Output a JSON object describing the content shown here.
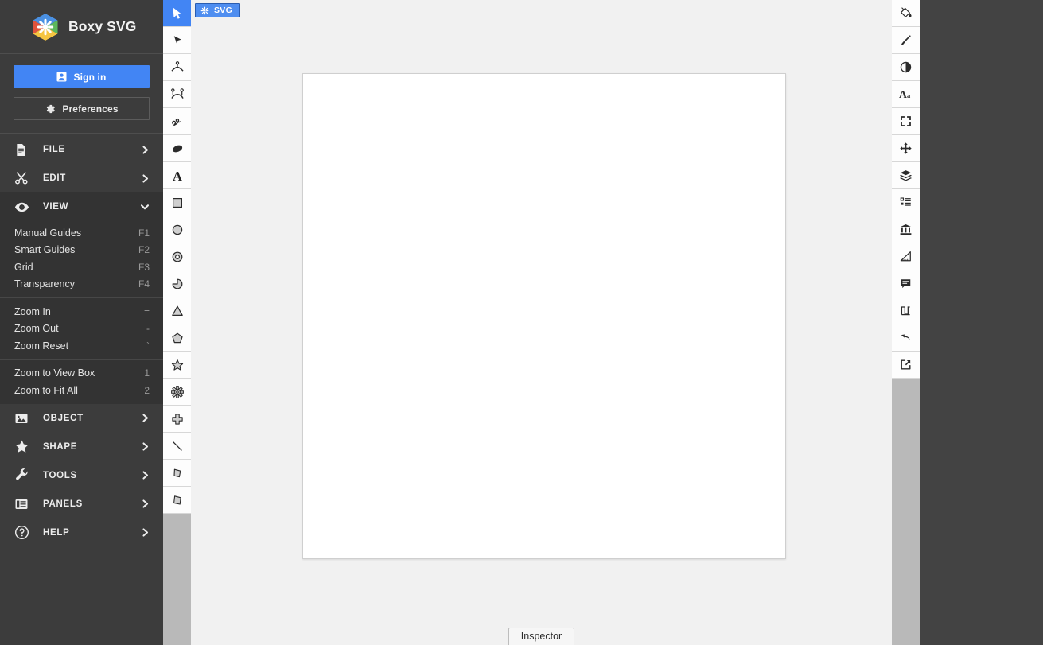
{
  "app": {
    "name": "Boxy SVG",
    "logo_icon": "boxy-svg-logo"
  },
  "colors": {
    "accent_blue": "#4285f4",
    "sidebar_bg": "#3c3c3c",
    "submenu_bg": "#333333",
    "toolbar_bg": "#b9b9b9",
    "canvas_bg": "#f1f1f1",
    "artboard_bg": "#ffffff",
    "right_panel_bg": "#434343"
  },
  "sidebar": {
    "signin_label": "Sign in",
    "signin_icon": "user-badge-icon",
    "preferences_label": "Preferences",
    "preferences_icon": "gear-icon",
    "menu": [
      {
        "label": "FILE",
        "icon": "file-document-icon",
        "expanded": false,
        "arrow": "chevron-right-icon"
      },
      {
        "label": "EDIT",
        "icon": "scissors-icon",
        "expanded": false,
        "arrow": "chevron-right-icon"
      },
      {
        "label": "VIEW",
        "icon": "eye-icon",
        "expanded": true,
        "arrow": "chevron-down-icon",
        "groups": [
          [
            {
              "label": "Manual Guides",
              "shortcut": "F1"
            },
            {
              "label": "Smart Guides",
              "shortcut": "F2"
            },
            {
              "label": "Grid",
              "shortcut": "F3"
            },
            {
              "label": "Transparency",
              "shortcut": "F4"
            }
          ],
          [
            {
              "label": "Zoom In",
              "shortcut": "="
            },
            {
              "label": "Zoom Out",
              "shortcut": "-"
            },
            {
              "label": "Zoom Reset",
              "shortcut": "`"
            }
          ],
          [
            {
              "label": "Zoom to View Box",
              "shortcut": "1"
            },
            {
              "label": "Zoom to Fit All",
              "shortcut": "2"
            }
          ]
        ]
      },
      {
        "label": "OBJECT",
        "icon": "image-icon",
        "expanded": false,
        "arrow": "chevron-right-icon"
      },
      {
        "label": "SHAPE",
        "icon": "star-icon",
        "expanded": false,
        "arrow": "chevron-right-icon"
      },
      {
        "label": "TOOLS",
        "icon": "wrench-icon",
        "expanded": false,
        "arrow": "chevron-right-icon"
      },
      {
        "label": "PANELS",
        "icon": "panels-icon",
        "expanded": false,
        "arrow": "chevron-right-icon"
      },
      {
        "label": "HELP",
        "icon": "question-circle-icon",
        "expanded": false,
        "arrow": "chevron-right-icon"
      }
    ]
  },
  "toolbar_left": {
    "tools": [
      {
        "name": "select-tool",
        "icon": "cursor-arrow-icon",
        "active": true
      },
      {
        "name": "direct-select-tool",
        "icon": "solid-arrow-icon",
        "active": false
      },
      {
        "name": "edit-nodes-tool",
        "icon": "node-single-icon",
        "active": false
      },
      {
        "name": "edit-handles-tool",
        "icon": "node-double-icon",
        "active": false
      },
      {
        "name": "freehand-tool",
        "icon": "squiggle-icon",
        "active": false
      },
      {
        "name": "brush-tool",
        "icon": "blob-icon",
        "active": false
      },
      {
        "name": "text-tool",
        "icon": "letter-a-icon",
        "active": false
      },
      {
        "name": "rectangle-tool",
        "icon": "square-icon",
        "active": false
      },
      {
        "name": "ellipse-tool",
        "icon": "circle-icon",
        "active": false
      },
      {
        "name": "ring-tool",
        "icon": "donut-icon",
        "active": false
      },
      {
        "name": "pie-tool",
        "icon": "pie-slice-icon",
        "active": false
      },
      {
        "name": "triangle-tool",
        "icon": "triangle-icon",
        "active": false
      },
      {
        "name": "polygon-tool",
        "icon": "pentagon-icon",
        "active": false
      },
      {
        "name": "star-tool",
        "icon": "star-outline-icon",
        "active": false
      },
      {
        "name": "gear-shape-tool",
        "icon": "gear-shape-icon",
        "active": false
      },
      {
        "name": "cross-tool",
        "icon": "plus-cross-icon",
        "active": false
      },
      {
        "name": "line-tool",
        "icon": "diagonal-line-icon",
        "active": false
      },
      {
        "name": "polyline-tool",
        "icon": "polyline-icon",
        "active": false
      },
      {
        "name": "polygon-path-tool",
        "icon": "quad-shape-icon",
        "active": false
      }
    ]
  },
  "toolbar_right": {
    "panels": [
      {
        "name": "fill-panel",
        "icon": "paint-bucket-icon"
      },
      {
        "name": "stroke-panel",
        "icon": "paint-brush-icon"
      },
      {
        "name": "effects-panel",
        "icon": "contrast-circle-icon"
      },
      {
        "name": "typography-panel",
        "icon": "typography-aa-icon"
      },
      {
        "name": "geometry-panel",
        "icon": "bounding-box-icon"
      },
      {
        "name": "transform-panel",
        "icon": "move-arrows-icon"
      },
      {
        "name": "layers-panel",
        "icon": "layers-stack-icon"
      },
      {
        "name": "elements-panel",
        "icon": "element-list-icon"
      },
      {
        "name": "library-panel",
        "icon": "bank-columns-icon"
      },
      {
        "name": "measure-panel",
        "icon": "ruler-triangle-icon"
      },
      {
        "name": "comments-panel",
        "icon": "speech-bubble-icon"
      },
      {
        "name": "path-ops-panel",
        "icon": "path-ops-icon"
      },
      {
        "name": "history-panel",
        "icon": "undo-arrow-icon"
      },
      {
        "name": "export-panel",
        "icon": "export-arrow-icon"
      }
    ]
  },
  "center": {
    "tab": {
      "label": "SVG",
      "icon": "snowflake-icon"
    },
    "inspector_label": "Inspector"
  }
}
